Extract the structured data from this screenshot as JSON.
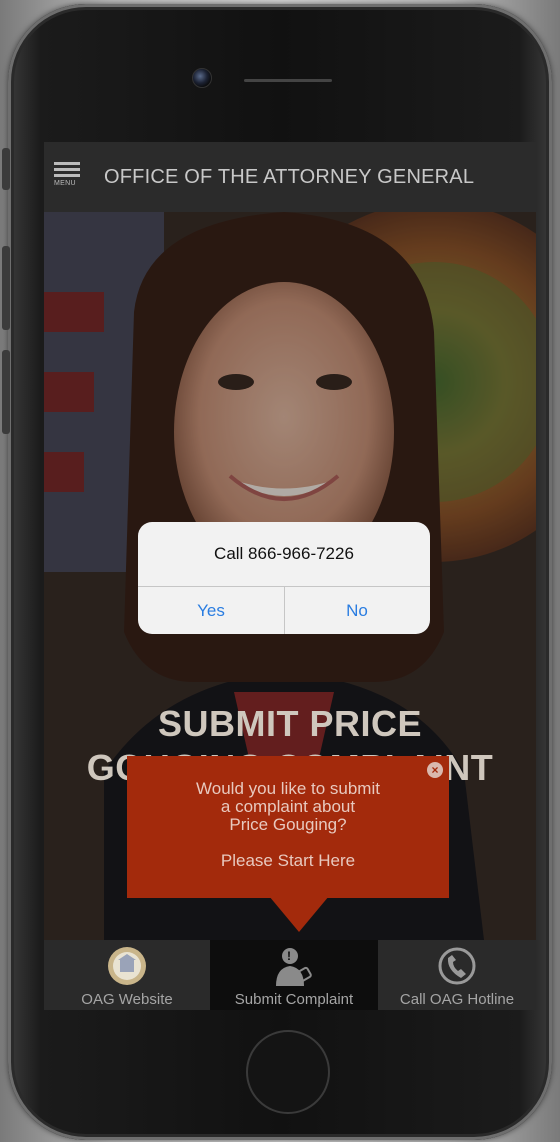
{
  "header": {
    "menu_label": "MENU",
    "title": "OFFICE OF THE ATTORNEY GENERAL"
  },
  "hero": {
    "headline_line1": "SUBMIT PRICE",
    "headline_line2": "GOUGING COMPLAINT"
  },
  "popup": {
    "question": "Would you like to submit\na complaint about\nPrice Gouging?",
    "cta": "Please Start Here",
    "close_icon": "close-icon",
    "color": "#a32a0c"
  },
  "dialog": {
    "message": "Call 866-966-7226",
    "yes_label": "Yes",
    "no_label": "No",
    "button_color": "#2a7de1"
  },
  "tabs": [
    {
      "label": "OAG Website",
      "icon": "seal-icon",
      "active": false
    },
    {
      "label": "Submit Complaint",
      "icon": "complaint-icon",
      "active": true
    },
    {
      "label": "Call OAG Hotline",
      "icon": "phone-icon",
      "active": false
    }
  ]
}
